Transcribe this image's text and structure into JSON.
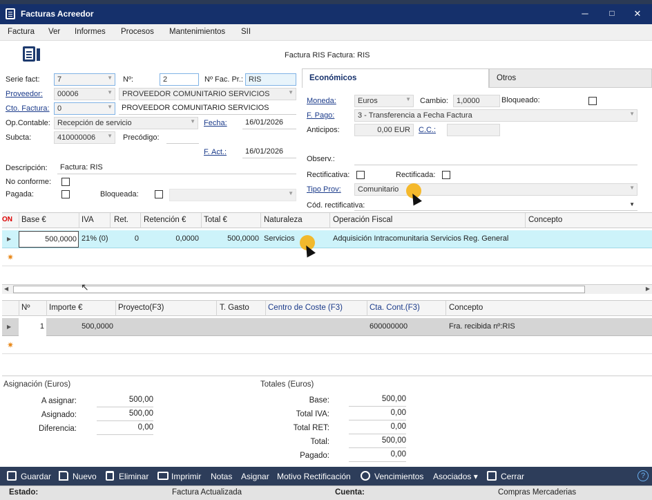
{
  "window": {
    "title": "Facturas Acreedor",
    "minimize": "─",
    "maximize": "□",
    "close": "✕"
  },
  "menu": [
    "Factura",
    "Ver",
    "Informes",
    "Procesos",
    "Mantenimientos",
    "SII"
  ],
  "header_caption": "Factura RIS  Factura: RIS",
  "form": {
    "serie_label": "Serie fact:",
    "serie_value": "7",
    "num_label": "Nº:",
    "num_value": "2",
    "nfacpr_label": "Nº Fac. Pr.:",
    "nfacpr_value": "RIS",
    "proveedor_label": "Proveedor:",
    "proveedor_code": "00006",
    "proveedor_name": "PROVEEDOR COMUNITARIO SERVICIOS",
    "ctofactura_label": "Cto. Factura:",
    "ctofactura_code": "0",
    "ctofactura_name": "PROVEEDOR COMUNITARIO SERVICIOS",
    "opcontable_label": "Op.Contable:",
    "opcontable_value": "Recepción de servicio",
    "fecha_label": "Fecha:",
    "fecha_value": "16/01/2026",
    "subcta_label": "Subcta:",
    "subcta_value": "410000006",
    "precodigo_label": "Precódigo:",
    "precodigo_value": "",
    "fact_label": "F. Act.:",
    "fact_value": "16/01/2026",
    "descripcion_label": "Descripción:",
    "descripcion_value": "Factura: RIS",
    "noconforme_label": "No conforme:",
    "pagada_label": "Pagada:",
    "bloqueada_label": "Bloqueada:"
  },
  "tabs": [
    "Económicos",
    "Otros"
  ],
  "economicos": {
    "moneda_label": "Moneda:",
    "moneda_value": "Euros",
    "cambio_label": "Cambio:",
    "cambio_value": "1,0000",
    "bloqueado_label": "Bloqueado:",
    "fpago_label": "F. Pago:",
    "fpago_value": "3 - Transferencia a Fecha Factura",
    "anticipos_label": "Anticipos:",
    "anticipos_value": "0,00 EUR",
    "cc_label": "C.C.:",
    "cc_value": "",
    "observ_label": "Observ.:",
    "rectificativa_label": "Rectificativa:",
    "rectificada_label": "Rectificada:",
    "tipoprov_label": "Tipo Prov:",
    "tipoprov_value": "Comunitario",
    "codrect_label": "Cód. rectificativa:"
  },
  "grid1": {
    "on_label": "ON",
    "headers": [
      "Base €",
      "IVA",
      "Ret.",
      "Retención €",
      "Total €",
      "Naturaleza",
      "Operación Fiscal",
      "Concepto"
    ],
    "row": [
      "500,0000",
      "21% (0)",
      "0",
      "0,0000",
      "500,0000",
      "Servicios",
      "Adquisición Intracomunitaria Servicios Reg. General",
      ""
    ]
  },
  "grid2": {
    "headers": [
      "Nº",
      "Importe €",
      "Proyecto(F3)",
      "T. Gasto",
      "Centro de Coste (F3)",
      "Cta. Cont.(F3)",
      "Concepto"
    ],
    "row": [
      "1",
      "500,0000",
      "",
      "",
      "",
      "600000000",
      "Fra. recibida nº:RIS"
    ]
  },
  "asignacion": {
    "title": "Asignación (Euros)",
    "rows": [
      {
        "label": "A asignar:",
        "value": "500,00"
      },
      {
        "label": "Asignado:",
        "value": "500,00"
      },
      {
        "label": "Diferencia:",
        "value": "0,00"
      }
    ]
  },
  "totales": {
    "title": "Totales (Euros)",
    "rows": [
      {
        "label": "Base:",
        "value": "500,00"
      },
      {
        "label": "Total IVA:",
        "value": "0,00"
      },
      {
        "label": "Total RET:",
        "value": "0,00"
      },
      {
        "label": "Total:",
        "value": "500,00"
      },
      {
        "label": "Pagado:",
        "value": "0,00"
      }
    ]
  },
  "toolbar": {
    "guardar": "Guardar",
    "nuevo": "Nuevo",
    "eliminar": "Eliminar",
    "imprimir": "Imprimir",
    "notas": "Notas",
    "asignar": "Asignar",
    "motivo": "Motivo Rectificación",
    "vencimientos": "Vencimientos",
    "asociados": "Asociados ▾",
    "cerrar": "Cerrar",
    "help": "?"
  },
  "status": {
    "estado_label": "Estado:",
    "estado_value": "Factura Actualizada",
    "cuenta_label": "Cuenta:",
    "cuenta_value": "Compras Mercaderias"
  },
  "colors": {
    "titlebar": "#15306b",
    "toolbar": "#2d3d5a",
    "selected_row": "#cdf3fa",
    "link": "#1a3a8a"
  }
}
